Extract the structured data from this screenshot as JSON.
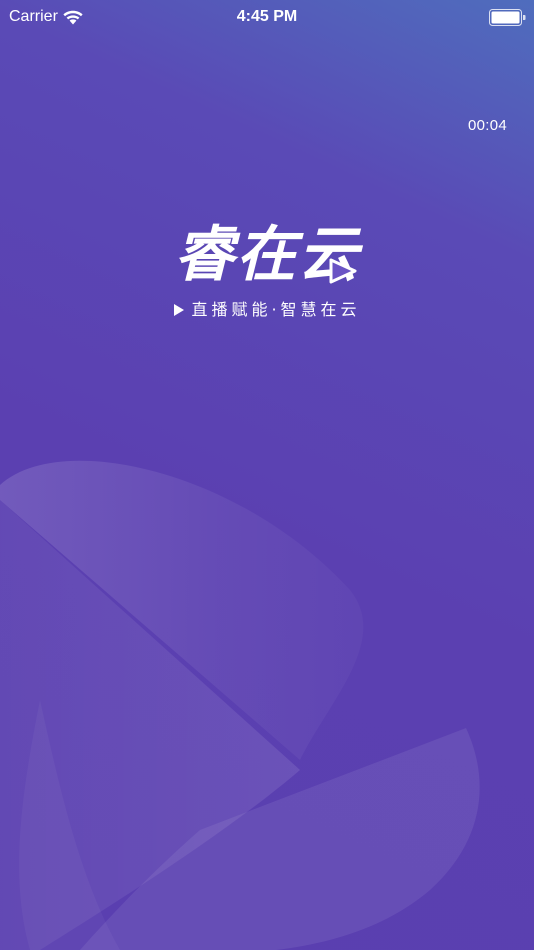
{
  "status_bar": {
    "carrier": "Carrier",
    "time": "4:45 PM",
    "icons": [
      "wifi-icon",
      "battery-icon"
    ]
  },
  "splash": {
    "countdown": "00:04",
    "brand_name_main": "睿在",
    "brand_name_last": "云",
    "tagline": "直播赋能·智慧在云",
    "icons": [
      "play-icon"
    ]
  },
  "colors": {
    "background_top": "#4f6dbd",
    "background_main": "#5a40b1",
    "text": "#ffffff"
  }
}
